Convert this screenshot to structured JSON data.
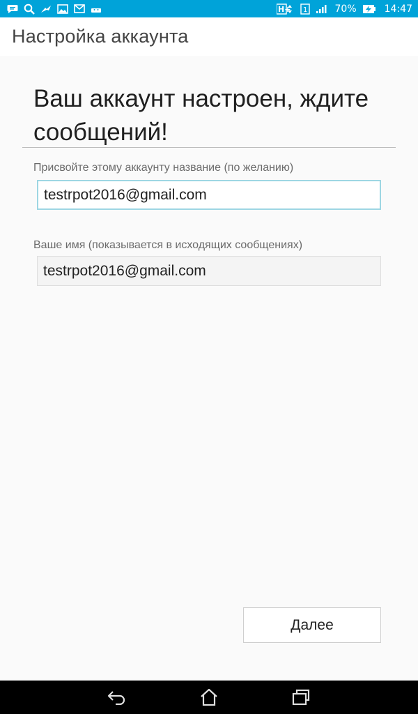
{
  "status_bar": {
    "icons_left": [
      "chat-icon",
      "search-icon",
      "bird-icon",
      "image-icon",
      "mail-icon",
      "android-icon"
    ],
    "network": "H+",
    "sim": "1",
    "battery_percent": "70%",
    "time": "14:47",
    "color": "#00a3d9"
  },
  "app_bar": {
    "title": "Настройка аккаунта"
  },
  "main": {
    "heading": "Ваш аккаунт настроен, ждите сообщений!",
    "account_name_label": "Присвойте этому аккаунту название (по желанию)",
    "account_name_value": "testrpot2016@gmail.com",
    "your_name_label": "Ваше имя (показывается в исходящих сообщениях)",
    "your_name_value": "testrpot2016@gmail.com",
    "next_label": "Далее"
  },
  "nav_bar": {
    "buttons": [
      "back-icon",
      "home-icon",
      "recent-apps-icon"
    ]
  }
}
